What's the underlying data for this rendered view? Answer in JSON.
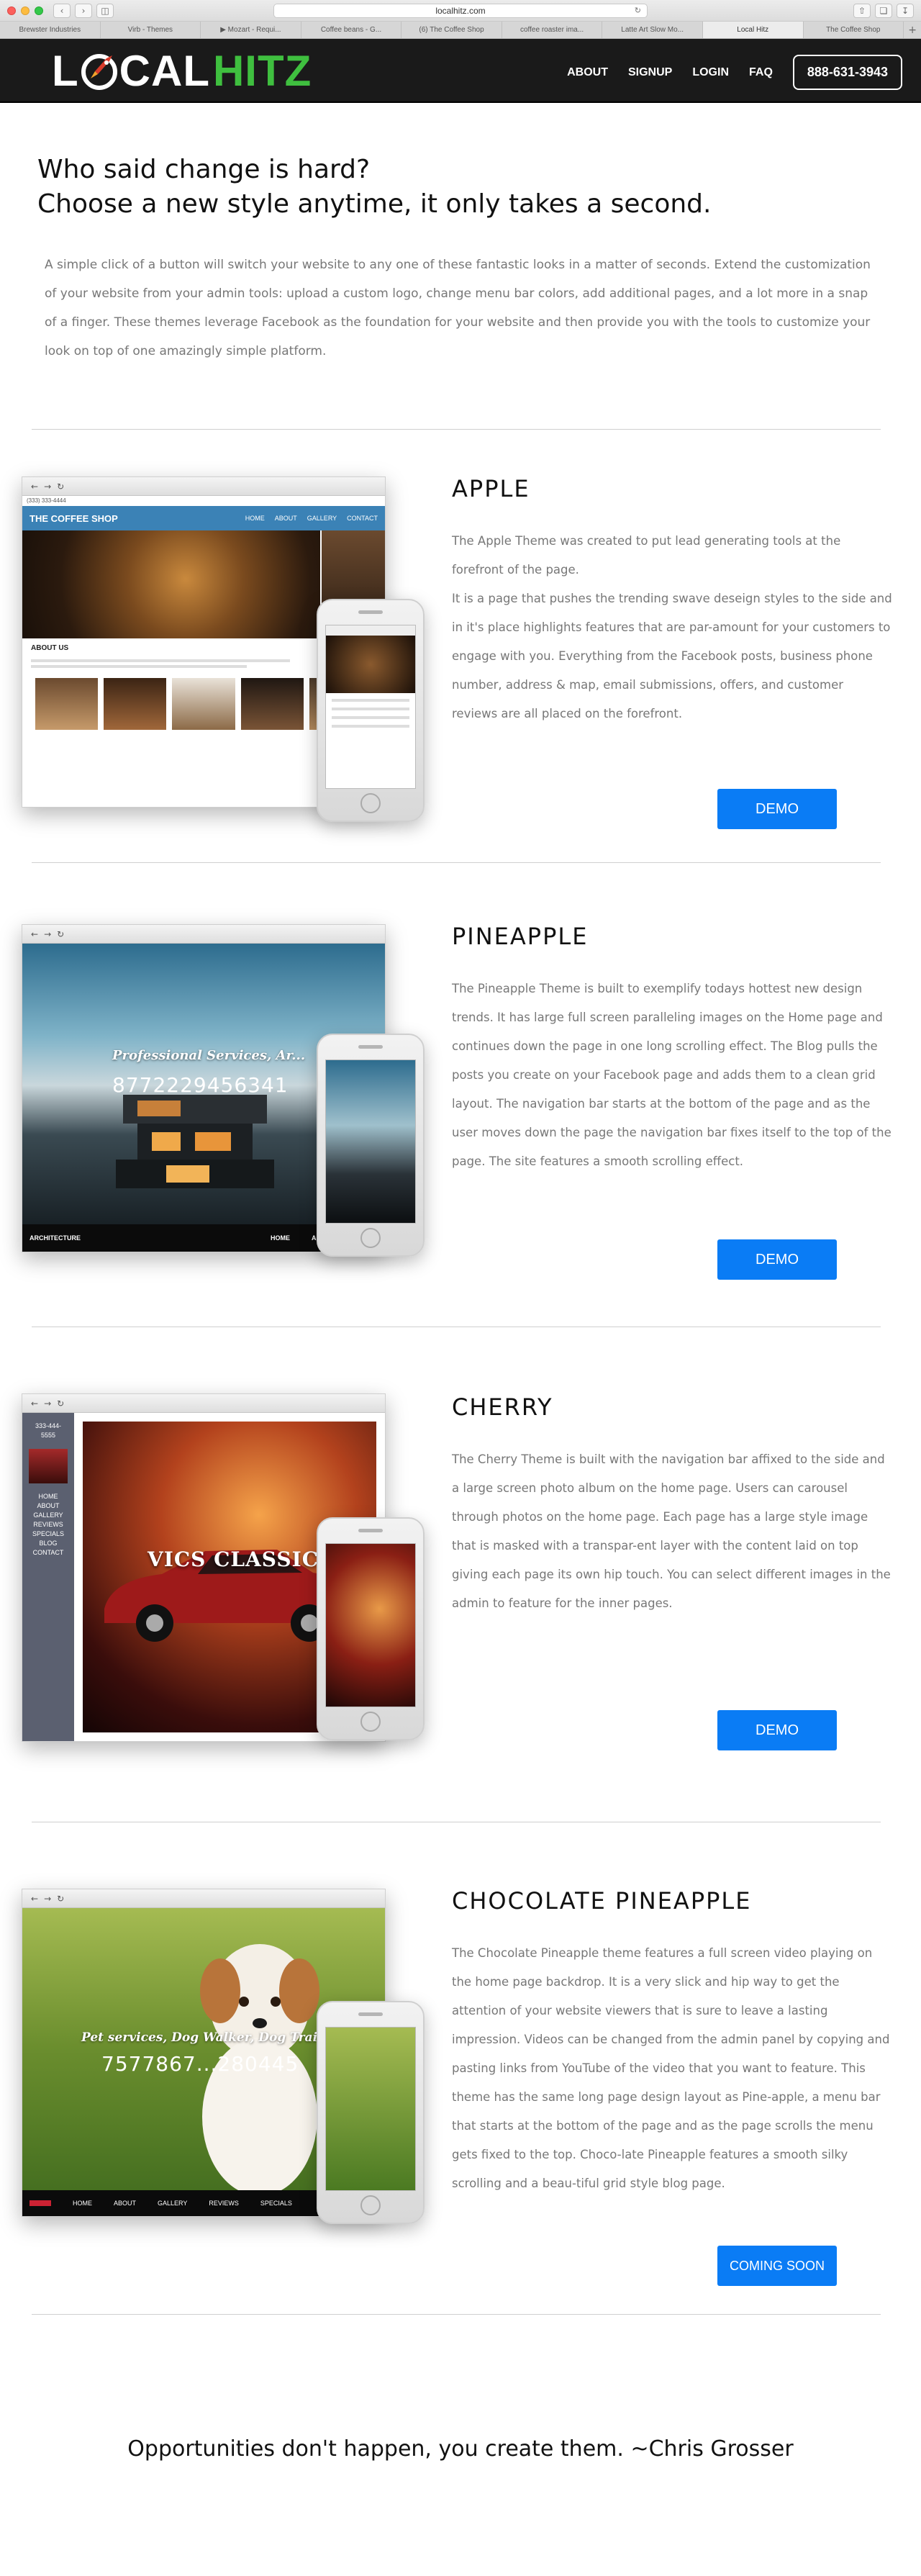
{
  "browser": {
    "url": "localhitz.com",
    "tabs": [
      "Brewster Industries",
      "Virb - Themes",
      "▶ Mozart - Requi...",
      "Coffee beans - G...",
      "(6) The Coffee Shop",
      "coffee roaster ima...",
      "Latte Art Slow Mo...",
      "Local Hitz",
      "The Coffee Shop"
    ],
    "active_tab_index": 7,
    "add_tab_label": "+"
  },
  "header": {
    "logo_l": "L",
    "logo_cal": "CAL",
    "logo_hitz": "HITZ",
    "nav": [
      "ABOUT",
      "SIGNUP",
      "LOGIN",
      "FAQ"
    ],
    "phone": "888-631-3943",
    "brand_green": "#3fbf3f"
  },
  "intro": {
    "heading_line1": "Who said change is hard?",
    "heading_line2": "Choose a new style anytime, it only takes a second.",
    "body": "A simple click of a button will switch  your website to any one of these fantastic looks in a matter of seconds. Extend the customization of your website from your admin tools: upload a custom logo, change menu bar colors, add additional pages, and a lot more in a snap of a finger. These themes leverage Facebook as the foundation for your website and then provide you with the tools to customize your look on top of one amazingly simple platform."
  },
  "themes": [
    {
      "title": "APPLE",
      "description": "The Apple Theme was created to put lead generating tools at the forefront of the page.\nIt is a page that pushes the trending swave deseign styles to the side and in it's place highlights features that are par-amount for your customers to engage with you. Everything from the Facebook posts, business phone number, address & map, email submissions, offers, and customer reviews are all placed on the forefront.",
      "button": "DEMO",
      "mock": {
        "site_name": "THE COFFEE SHOP",
        "nav_links": [
          "HOME",
          "ABOUT",
          "GALLERY",
          "CONTACT"
        ],
        "section": "ABOUT US",
        "phone_header": "(333) 333-4444"
      }
    },
    {
      "title": "PINEAPPLE",
      "description": "The Pineapple Theme is built to exemplify todays hottest new design trends. It has large full screen paralleling images on the Home page and continues down the page in one long scrolling effect. The Blog pulls the posts you create on your Facebook page and adds them to a clean grid layout. The navigation bar starts at the bottom of the page and as the user moves down the page the navigation bar fixes itself to the top of the page. The site features a smooth scrolling effect.",
      "button": "DEMO",
      "mock": {
        "overlay": "Professional Services, Ar...",
        "number": "8772229456341",
        "footer_brand": "ARCHITECTURE",
        "footer_links": [
          "HOME",
          "ABOUT"
        ]
      }
    },
    {
      "title": "CHERRY",
      "description": "The Cherry Theme is built with the navigation bar affixed to the side and a large screen photo album on the home page. Users can carousel through photos on the home page. Each page has a large style image that is masked with a transpar-ent layer with the content laid on top giving each page its own hip touch. You can select different images in the admin to feature for the inner pages.",
      "button": "DEMO",
      "mock": {
        "phone": "333-444-5555",
        "side_links": [
          "HOME",
          "ABOUT",
          "GALLERY",
          "REVIEWS",
          "SPECIALS",
          "BLOG",
          "CONTACT"
        ],
        "photo_title": "VICS CLASSIC C"
      }
    },
    {
      "title": "CHOCOLATE PINEAPPLE",
      "description": "The Chocolate Pineapple theme features a full screen video playing on the home page backdrop. It is a very slick and hip way to get the attention of your website viewers that is sure to leave a lasting impression. Videos can be changed from the admin panel by copying and pasting links from YouTube of the video that you want to feature. This theme has the same long page design layout as Pine-apple, a menu bar that starts at the bottom of the page and as the page scrolls the menu gets fixed to the top. Choco-late Pineapple features a smooth silky scrolling and a beau-tiful grid style blog page.",
      "button": "COMING SOON",
      "mock": {
        "overlay": "Pet services, Dog Walker, Dog Trainin...",
        "number": "7577867...280445",
        "footer_links": [
          "HOME",
          "ABOUT",
          "GALLERY",
          "REVIEWS",
          "SPECIALS"
        ]
      }
    }
  ],
  "quote": "Opportunities don't happen, you create them. ~Chris Grosser",
  "colors": {
    "button_blue": "#0a7cf5",
    "header_bg": "#1a1a1a"
  }
}
